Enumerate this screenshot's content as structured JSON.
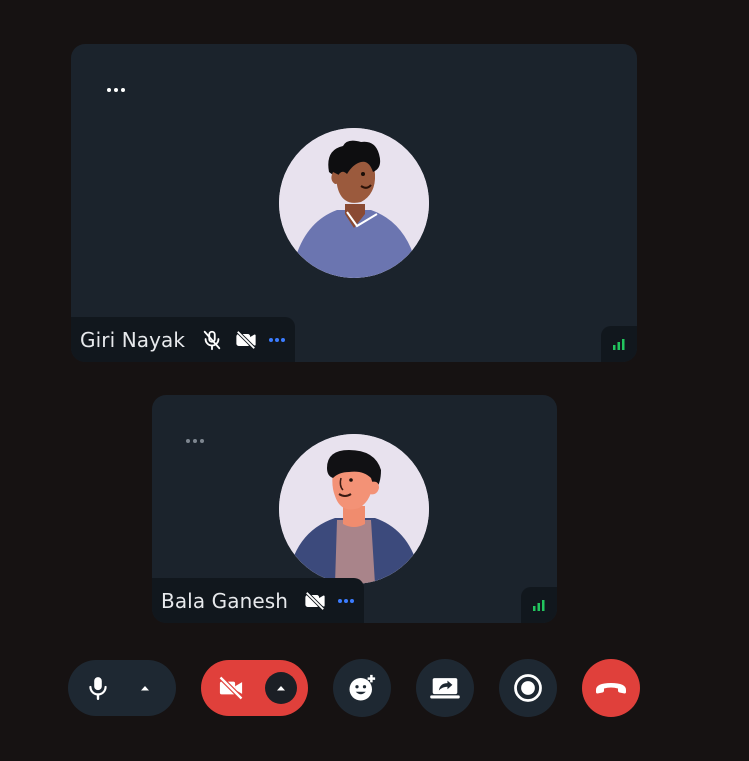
{
  "participants": [
    {
      "name": "Giri Nayak",
      "mic": "muted",
      "camera": "off"
    },
    {
      "name": "Bala Ganesh",
      "camera": "off"
    }
  ],
  "icons": {
    "more": "more-horizontal-icon",
    "mic_muted": "mic-off-icon",
    "camera_off": "video-off-icon",
    "signal": "signal-bars-icon",
    "mic": "mic-icon",
    "caret": "caret-up-icon",
    "reactions": "emoji-add-icon",
    "share": "screen-share-icon",
    "record": "record-icon",
    "leave": "hang-up-icon"
  },
  "colors": {
    "background": "#161212",
    "tile": "#1b232c",
    "danger": "#e0403b",
    "accent": "#3b7cff",
    "signal": "#22c55e"
  }
}
